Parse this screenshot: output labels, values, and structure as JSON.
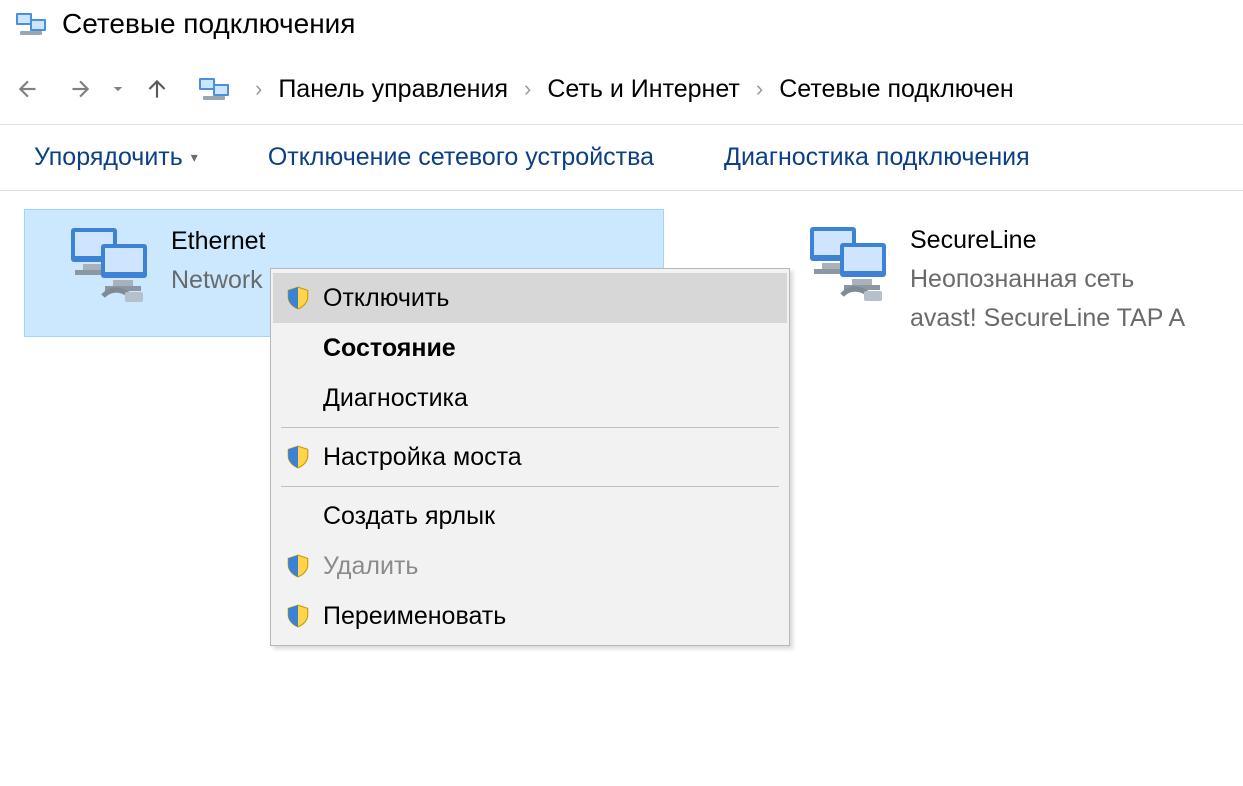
{
  "window": {
    "title": "Сетевые подключения"
  },
  "breadcrumbs": {
    "b0": "Панель управления",
    "b1": "Сеть и Интернет",
    "b2": "Сетевые подключен"
  },
  "toolbar": {
    "organize": "Упорядочить",
    "disable_device": "Отключение сетевого устройства",
    "diagnose": "Диагностика подключения"
  },
  "connections": {
    "ethernet": {
      "name": "Ethernet",
      "sub1": "Network Connection"
    },
    "secureline": {
      "name": "SecureLine",
      "sub1": "Неопознанная сеть",
      "sub2": "avast! SecureLine TAP A"
    }
  },
  "context_menu": {
    "disable": "Отключить",
    "status": "Состояние",
    "diagnose": "Диагностика",
    "bridge": "Настройка моста",
    "shortcut": "Создать ярлык",
    "delete": "Удалить",
    "rename": "Переименовать"
  }
}
